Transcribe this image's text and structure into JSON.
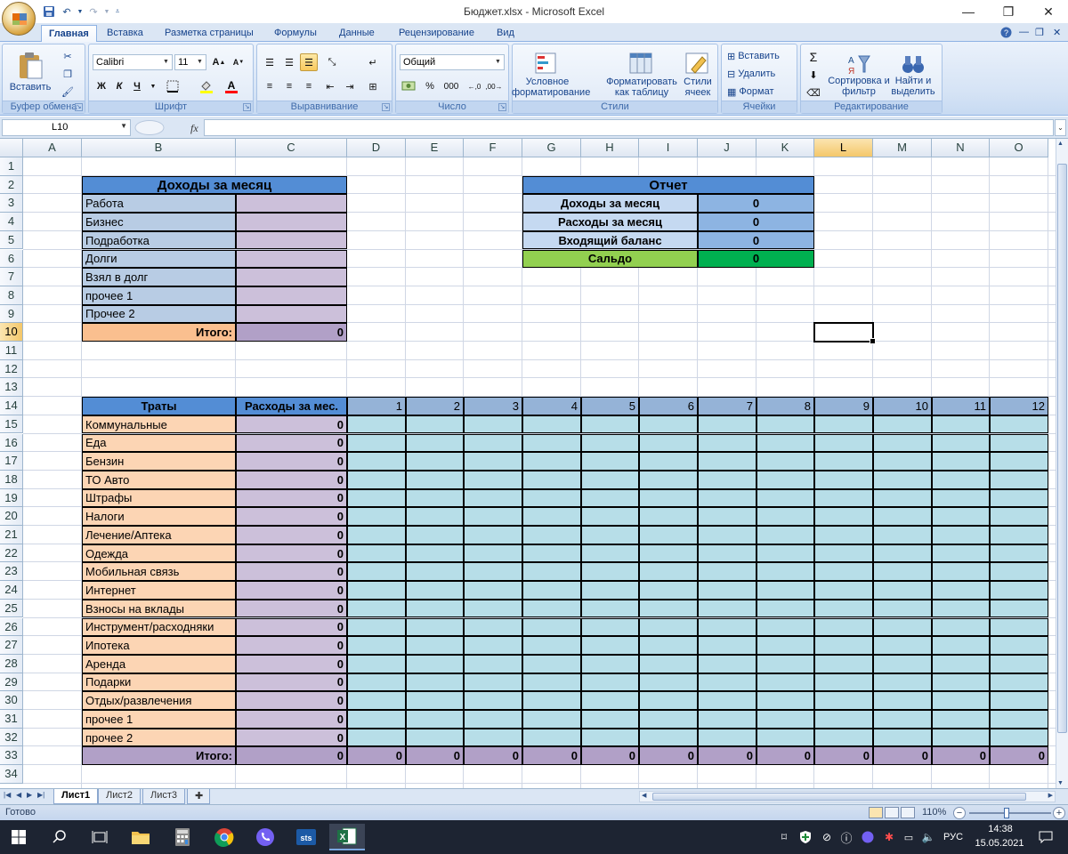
{
  "window": {
    "title": "Бюджет.xlsx - Microsoft Excel",
    "minimize": "—",
    "restore": "❐",
    "close": "✕"
  },
  "ribbon_tabs": [
    {
      "label": "Главная",
      "active": true
    },
    {
      "label": "Вставка"
    },
    {
      "label": "Разметка страницы"
    },
    {
      "label": "Формулы"
    },
    {
      "label": "Данные"
    },
    {
      "label": "Рецензирование"
    },
    {
      "label": "Вид"
    }
  ],
  "ribbon": {
    "clipboard": {
      "label": "Буфер обмена",
      "paste": "Вставить"
    },
    "font": {
      "label": "Шрифт",
      "name": "Calibri",
      "size": "11",
      "bold": "Ж",
      "italic": "К",
      "underline": "Ч"
    },
    "alignment": {
      "label": "Выравнивание"
    },
    "number": {
      "label": "Число",
      "format": "Общий",
      "percent": "%",
      "thousands": "000"
    },
    "styles": {
      "label": "Стили",
      "conditional": "Условное форматирование",
      "as_table": "Форматировать как таблицу",
      "cell_styles": "Стили ячеек"
    },
    "cells": {
      "label": "Ячейки",
      "insert": "Вставить",
      "delete": "Удалить",
      "format": "Формат"
    },
    "editing": {
      "label": "Редактирование",
      "sort": "Сортировка и фильтр",
      "find": "Найти и выделить"
    }
  },
  "formula_bar": {
    "name_box": "L10",
    "fx": "fx",
    "formula": ""
  },
  "columns": [
    "A",
    "B",
    "C",
    "D",
    "E",
    "F",
    "G",
    "H",
    "I",
    "J",
    "K",
    "L",
    "M",
    "N",
    "O"
  ],
  "active_column": "L",
  "active_row": 10,
  "rows": [
    1,
    2,
    3,
    4,
    5,
    6,
    7,
    8,
    9,
    10,
    11,
    12,
    13,
    14,
    15,
    16,
    17,
    18,
    19,
    20,
    21,
    22,
    23,
    24,
    25,
    26,
    27,
    28,
    29,
    30,
    31,
    32,
    33,
    34
  ],
  "income": {
    "title": "Доходы за месяц",
    "items": [
      "Работа",
      "Бизнес",
      "Подработка",
      "Долги",
      "Взял в долг",
      "прочее 1",
      "Прочее 2"
    ],
    "total_label": "Итого:",
    "total_value": "0"
  },
  "report": {
    "title": "Отчет",
    "rows": [
      {
        "label": "Доходы за месяц",
        "value": "0"
      },
      {
        "label": "Расходы за месяц",
        "value": "0"
      },
      {
        "label": "Входящий баланс",
        "value": "0"
      },
      {
        "label": "Сальдо",
        "value": "0"
      }
    ]
  },
  "expenses": {
    "header_name": "Траты",
    "header_total": "Расходы за мес.",
    "days": [
      "1",
      "2",
      "3",
      "4",
      "5",
      "6",
      "7",
      "8",
      "9",
      "10",
      "11",
      "12"
    ],
    "items": [
      "Коммунальные",
      "Еда",
      "Бензин",
      "ТО Авто",
      "Штрафы",
      "Налоги",
      "Лечение/Аптека",
      "Одежда",
      "Мобильная связь",
      "Интернет",
      "Взносы на вклады",
      "Инструмент/расходняки",
      "Ипотека",
      "Аренда",
      "Подарки",
      "Отдых/развлечения",
      "прочее 1",
      "прочее 2"
    ],
    "item_value": "0",
    "total_label": "Итого:",
    "total_value": "0",
    "day_totals": [
      "0",
      "0",
      "0",
      "0",
      "0",
      "0",
      "0",
      "0",
      "0",
      "0",
      "0",
      "0"
    ]
  },
  "sheets": [
    {
      "label": "Лист1",
      "active": true
    },
    {
      "label": "Лист2"
    },
    {
      "label": "Лист3"
    }
  ],
  "status": {
    "text": "Готово",
    "zoom": "110%"
  },
  "taskbar": {
    "lang": "РУС",
    "time": "14:38",
    "date": "15.05.2021"
  },
  "colors": {
    "income_header": "#538dd5",
    "income_label": "#b8cce4",
    "income_value": "#ccc0da",
    "total_orange": "#fabf8f",
    "total_purple": "#b1a0c7",
    "report_row": "#c5d9f1",
    "report_value": "#8db4e2",
    "saldo_label": "#92d050",
    "saldo_value": "#00b050",
    "expense_label": "#fcd5b4",
    "expense_value": "#ccc0da",
    "day_cell": "#b7dee8",
    "day_header": "#95b3d7"
  }
}
